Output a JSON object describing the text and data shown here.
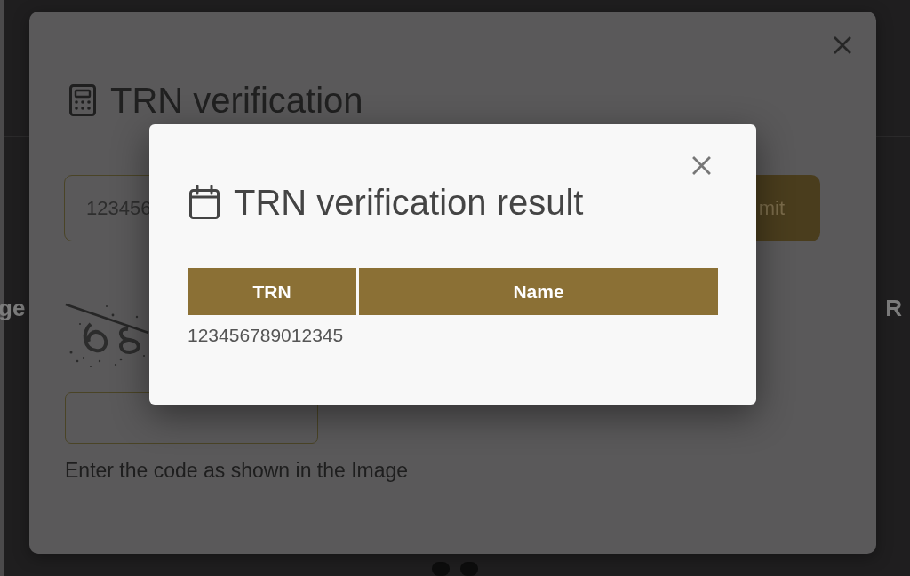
{
  "page": {
    "left_text": "ge",
    "right_text": "R"
  },
  "verification_dialog": {
    "title": "TRN verification",
    "trn_field": {
      "value": "123456"
    },
    "submit_button": {
      "label": "mit"
    },
    "captcha_hint": "Enter the code as shown in the Image"
  },
  "result_dialog": {
    "title": "TRN verification result",
    "table": {
      "columns": [
        "TRN",
        "Name"
      ],
      "rows": [
        [
          "123456789012345"
        ]
      ]
    }
  }
}
